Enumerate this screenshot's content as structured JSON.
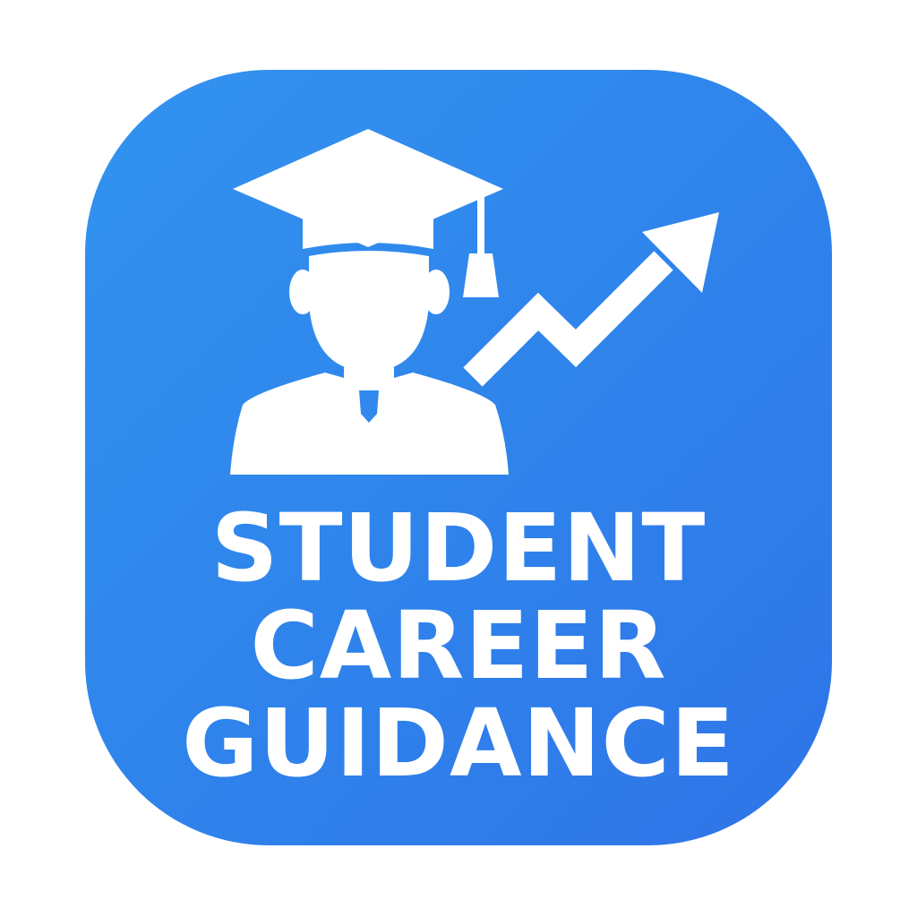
{
  "app_icon": {
    "title_lines": [
      "STUDENT",
      "CAREER",
      "GUIDANCE"
    ],
    "icons": [
      "graduate-student-icon",
      "trend-up-arrow-icon"
    ],
    "colors": {
      "background_top": "#3393ef",
      "background_bottom": "#2f74e8",
      "foreground": "#ffffff",
      "page": "#ffffff"
    }
  }
}
